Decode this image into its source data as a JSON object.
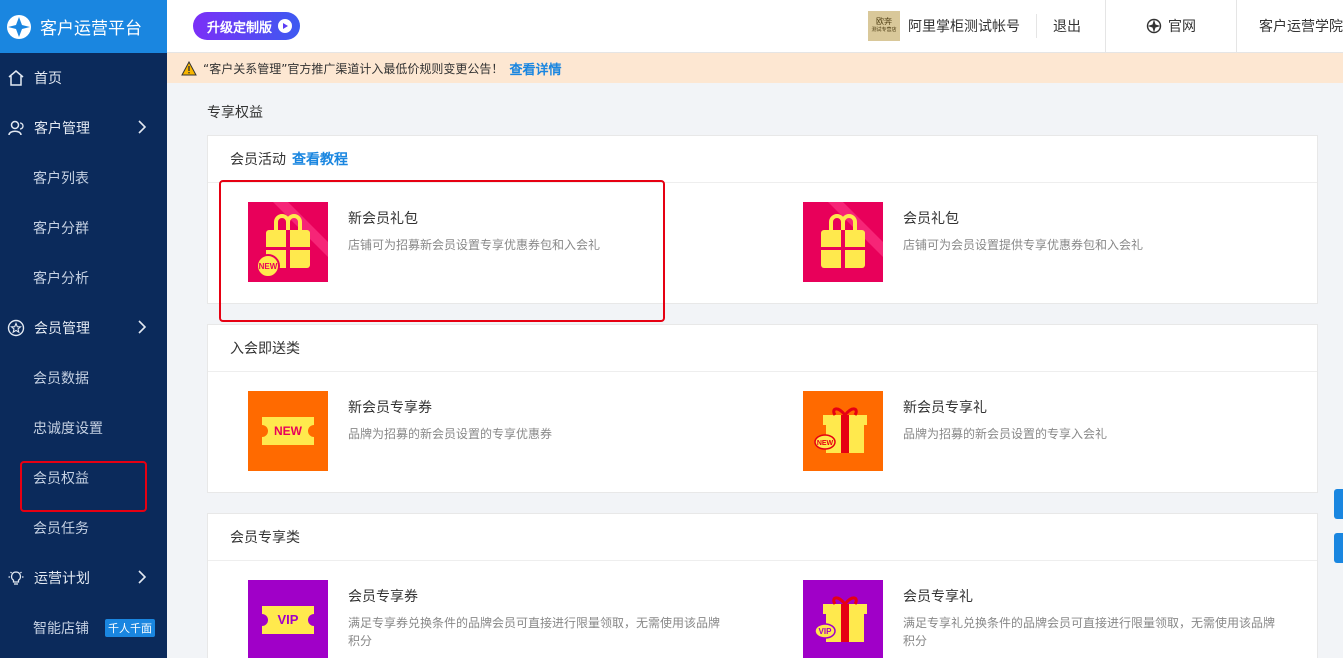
{
  "sidebar": {
    "brand": "客户运营平台",
    "items": [
      {
        "label": "首页",
        "type": "top",
        "icon": "home-icon"
      },
      {
        "label": "客户管理",
        "type": "top",
        "icon": "user-group-icon",
        "chevron": true
      },
      {
        "label": "客户列表",
        "type": "sub"
      },
      {
        "label": "客户分群",
        "type": "sub"
      },
      {
        "label": "客户分析",
        "type": "sub"
      },
      {
        "label": "会员管理",
        "type": "top",
        "icon": "star-circle-icon",
        "chevron": true
      },
      {
        "label": "会员数据",
        "type": "sub"
      },
      {
        "label": "忠诚度设置",
        "type": "sub"
      },
      {
        "label": "会员权益",
        "type": "sub",
        "highlighted": true
      },
      {
        "label": "会员任务",
        "type": "sub"
      },
      {
        "label": "运营计划",
        "type": "top",
        "icon": "lightbulb-icon",
        "chevron": true
      },
      {
        "label": "智能店铺",
        "type": "sub",
        "badge": "千人千面"
      }
    ]
  },
  "topbar": {
    "upgrade_label": "升级定制版",
    "account_name": "阿里掌柜测试帐号",
    "shop_logo_text_1": "欧奔",
    "shop_logo_text_2": "测试专营店",
    "logout_label": "退出",
    "official_site_label": "官网",
    "academy_label": "客户运营学院"
  },
  "notice": {
    "text": "“客户关系管理”官方推广渠道计入最低价规则变更公告！",
    "link": "查看详情"
  },
  "main": {
    "page_title": "专享权益",
    "sections": [
      {
        "title": "会员活动",
        "link": "查看教程",
        "cards": [
          {
            "title": "新会员礼包",
            "desc": "店铺可为招募新会员设置专享优惠券包和入会礼",
            "thumb": "new-member-gift-pack-icon"
          },
          {
            "title": "会员礼包",
            "desc": "店铺可为会员设置提供专享优惠券包和入会礼",
            "thumb": "member-gift-pack-icon"
          }
        ]
      },
      {
        "title": "入会即送类",
        "cards": [
          {
            "title": "新会员专享券",
            "desc": "品牌为招募的新会员设置的专享优惠券",
            "thumb": "new-coupon-icon",
            "thumb_text": "NEW"
          },
          {
            "title": "新会员专享礼",
            "desc": "品牌为招募的新会员设置的专享入会礼",
            "thumb": "new-gift-icon",
            "thumb_text": "NEW"
          }
        ]
      },
      {
        "title": "会员专享类",
        "cards": [
          {
            "title": "会员专享券",
            "desc": "满足专享券兑换条件的品牌会员可直接进行限量领取，无需使用该品牌积分",
            "thumb": "vip-coupon-icon",
            "thumb_text": "VIP"
          },
          {
            "title": "会员专享礼",
            "desc": "满足专享礼兑换条件的品牌会员可直接进行限量领取，无需使用该品牌积分",
            "thumb": "vip-gift-icon",
            "thumb_text": "VIP"
          }
        ]
      }
    ]
  },
  "colors": {
    "sidebar_bg": "#0b2a5b",
    "brand_blue": "#1a86e0",
    "highlight_red": "#e60012",
    "pink_thumb": "#e8005a",
    "orange_thumb": "#ff6a00",
    "purple_thumb": "#a000c8",
    "yellow_accent": "#ffe94d"
  }
}
